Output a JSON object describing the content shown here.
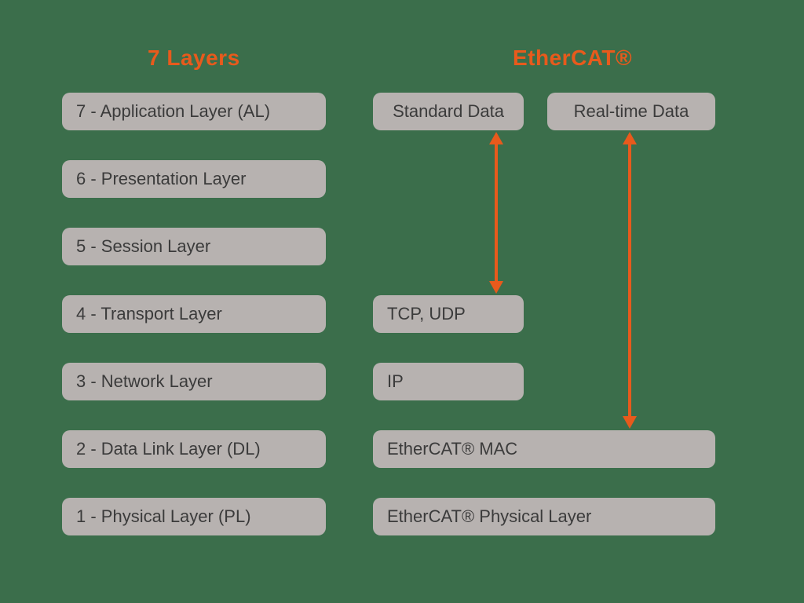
{
  "headings": {
    "layers": "7 Layers",
    "ethercat": "EtherCAT®"
  },
  "left_layers": [
    "7 - Application Layer (AL)",
    "6 - Presentation Layer",
    "5 - Session Layer",
    "4 - Transport Layer",
    "3 - Network Layer",
    "2 - Data Link Layer (DL)",
    "1 - Physical Layer (PL)"
  ],
  "right": {
    "row7": {
      "left": "Standard Data",
      "right": "Real-time Data"
    },
    "row4": "TCP, UDP",
    "row3": "IP",
    "row2": "EtherCAT® MAC",
    "row1": "EtherCAT® Physical Layer"
  },
  "arrows": [
    {
      "from": "standard-data-box",
      "to": "tcp-udp-box",
      "double": true
    },
    {
      "from": "realtime-data-box",
      "to": "ethercat-mac-box",
      "double": true
    }
  ]
}
